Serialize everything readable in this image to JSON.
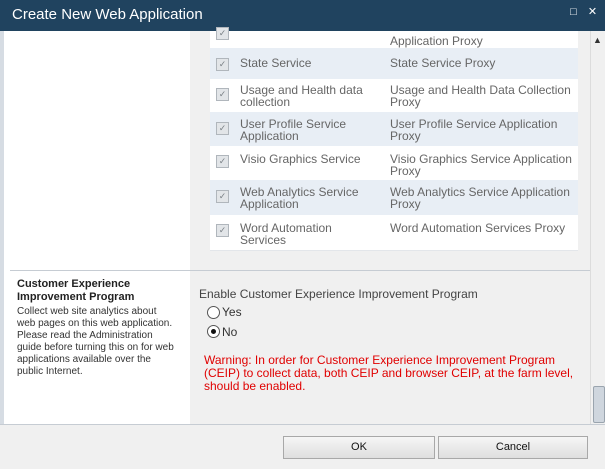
{
  "window": {
    "title": "Create New Web Application"
  },
  "titlebar_buttons": {
    "maximize": "□",
    "close": "✕"
  },
  "service_rows": [
    {
      "service": "",
      "proxy": "Application Proxy",
      "checked": true
    },
    {
      "service": "State Service",
      "proxy": "State Service Proxy",
      "checked": true
    },
    {
      "service": "Usage and Health data collection",
      "proxy": "Usage and Health Data Collection Proxy",
      "checked": true
    },
    {
      "service": "User Profile Service Application",
      "proxy": "User Profile Service Application Proxy",
      "checked": true
    },
    {
      "service": "Visio Graphics Service",
      "proxy": "Visio Graphics Service Application Proxy",
      "checked": true
    },
    {
      "service": "Web Analytics Service Application",
      "proxy": "Web Analytics Service Application Proxy",
      "checked": true
    },
    {
      "service": "Word Automation Services",
      "proxy": "Word Automation Services Proxy",
      "checked": true
    }
  ],
  "ceip": {
    "title": "Customer Experience Improvement Program",
    "description": "Collect web site analytics about web pages on this web application. Please read the Administration guide before turning this on for web applications available over the public Internet.",
    "enable_label": "Enable Customer Experience Improvement Program",
    "option_yes": "Yes",
    "option_no": "No",
    "selected": "No",
    "warning": "Warning: In order for Customer Experience Improvement Program (CEIP) to collect data, both CEIP and browser CEIP, at the farm level, should be enabled."
  },
  "buttons": {
    "ok": "OK",
    "cancel": "Cancel"
  },
  "colors": {
    "titlebar": "#20435f",
    "warning": "#e00000",
    "row_alt": "#e8eef5",
    "panel": "#f0f0f0"
  }
}
